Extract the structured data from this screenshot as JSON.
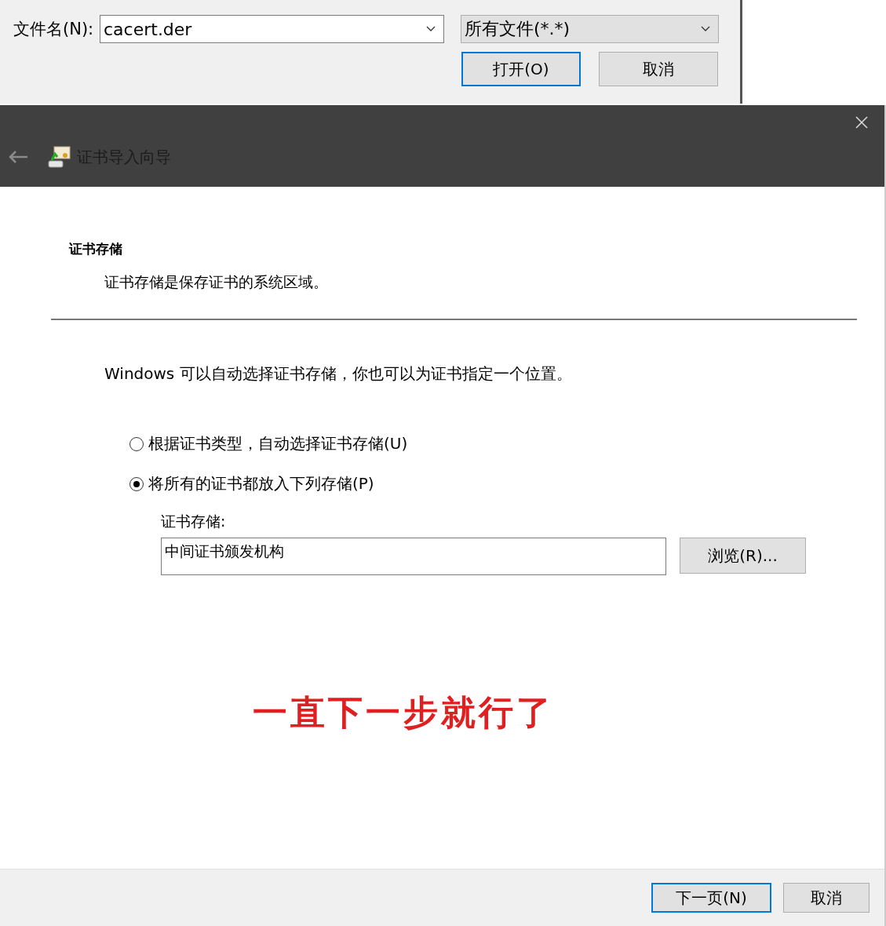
{
  "file_dialog": {
    "filename_label": "文件名(N):",
    "filename_value": "cacert.der",
    "filetype_value": "所有文件(*.*)",
    "buttons": [
      {
        "label": "打开(O)",
        "selected": true
      },
      {
        "label": "取消",
        "selected": false
      }
    ]
  },
  "wizard": {
    "title": "证书导入向导",
    "section_title": "证书存储",
    "section_desc": "证书存储是保存证书的系统区域。",
    "intro": "Windows 可以自动选择证书存储，你也可以为证书指定一个位置。",
    "options": [
      {
        "label": "根据证书类型，自动选择证书存储(U)",
        "selected": false
      },
      {
        "label": "将所有的证书都放入下列存储(P)",
        "selected": true
      }
    ],
    "store_label": "证书存储:",
    "store_value": "中间证书颁发机构",
    "browse_button": "浏览(R)...",
    "annotation": "一直下一步就行了",
    "footer_buttons": [
      {
        "label": "下一页(N)",
        "selected": true
      },
      {
        "label": "取消",
        "selected": false
      }
    ]
  }
}
